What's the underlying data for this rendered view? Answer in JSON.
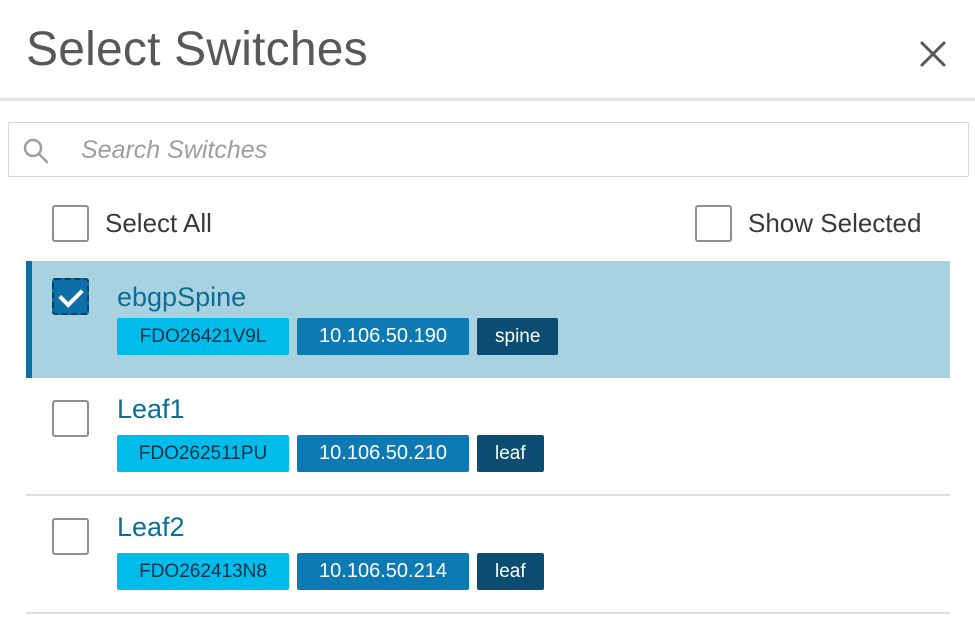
{
  "dialog": {
    "title": "Select Switches",
    "close_icon": "close-icon"
  },
  "search": {
    "placeholder": "Search Switches",
    "value": "",
    "icon": "search-icon"
  },
  "options": {
    "select_all": {
      "label": "Select All",
      "checked": false
    },
    "show_selected": {
      "label": "Show Selected",
      "checked": false
    }
  },
  "switches": [
    {
      "name": "ebgpSpine",
      "serial": "FDO26421V9L",
      "ip": "10.106.50.190",
      "role": "spine",
      "checked": true
    },
    {
      "name": "Leaf1",
      "serial": "FDO262511PU",
      "ip": "10.106.50.210",
      "role": "leaf",
      "checked": false
    },
    {
      "name": "Leaf2",
      "serial": "FDO262413N8",
      "ip": "10.106.50.214",
      "role": "leaf",
      "checked": false
    }
  ],
  "colors": {
    "selected_row_bg": "#a9d2e1",
    "accent": "#0e6ea6",
    "serial_tag": "#00bceb",
    "ip_tag": "#0d7ab3",
    "role_tag": "#0b4d70",
    "name_text": "#0d6d96"
  }
}
